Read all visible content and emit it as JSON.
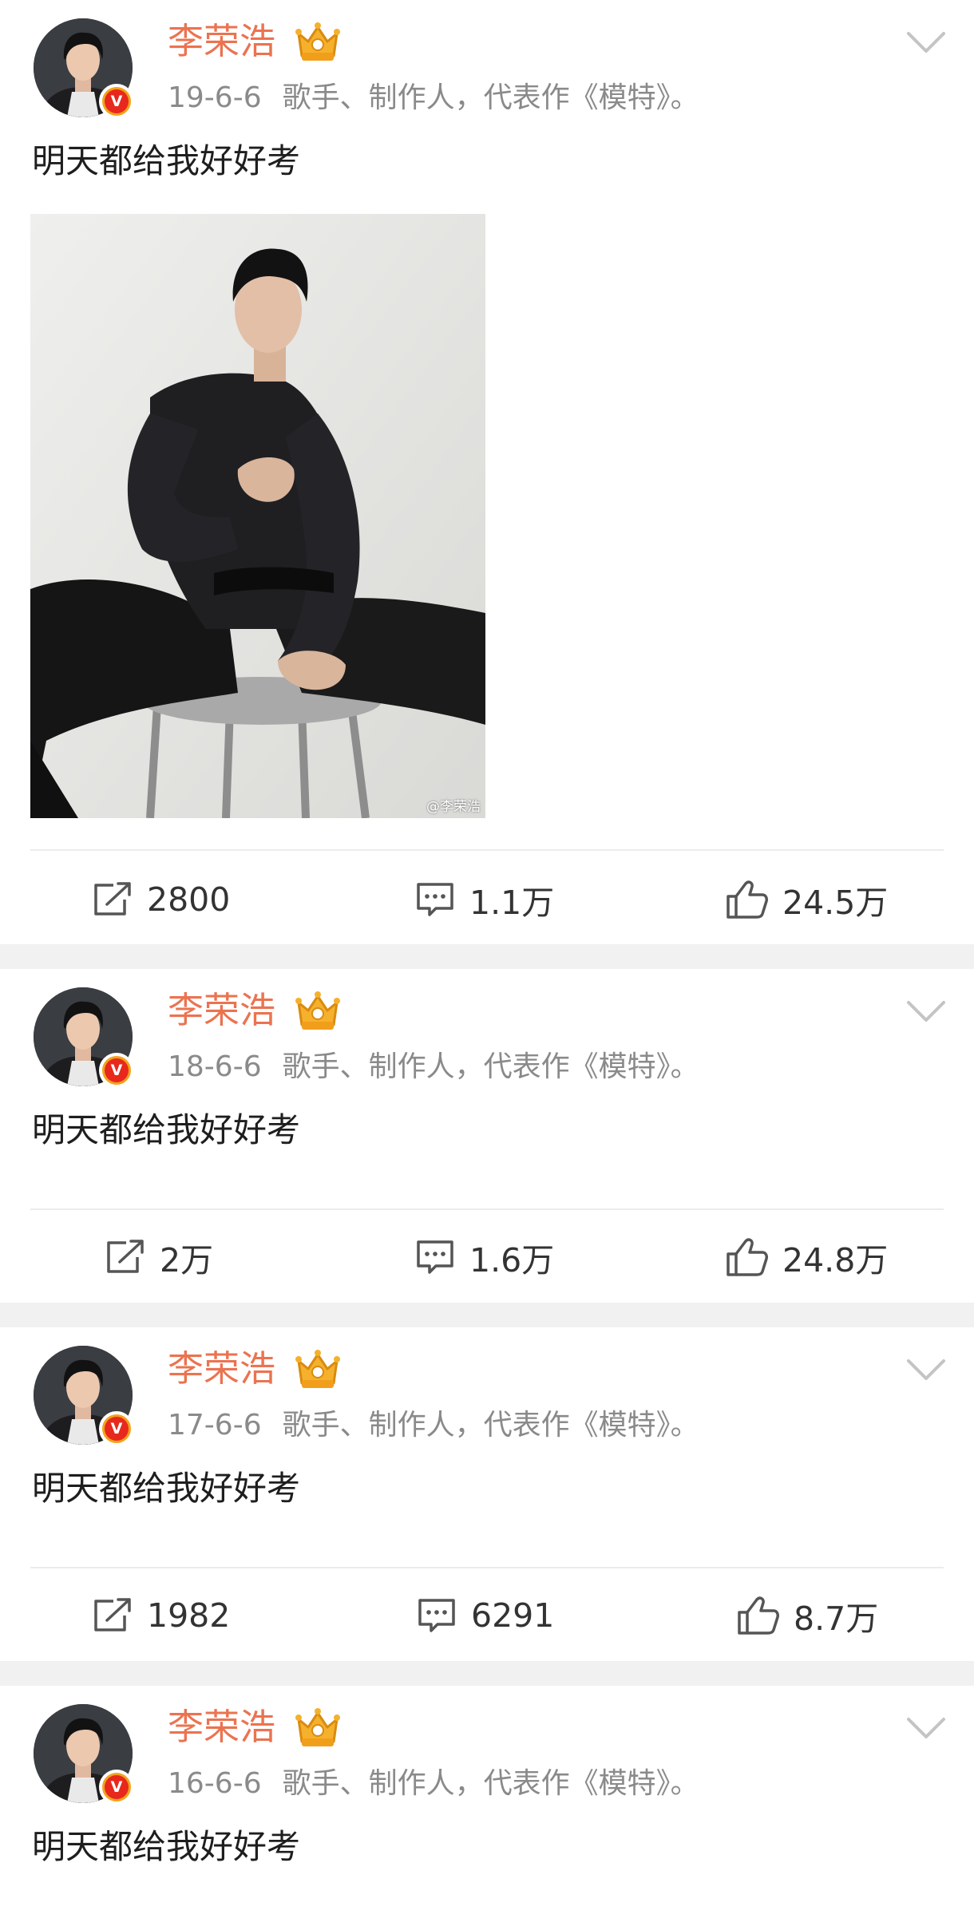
{
  "posts": [
    {
      "username": "李荣浩",
      "date": "19-6-6",
      "bio": "歌手、制作人，代表作《模特》。",
      "text": "明天都给我好好考",
      "has_photo": true,
      "photo_watermark": "@李荣浩",
      "repost_count": "2800",
      "comment_count": "1.1万",
      "like_count": "24.5万"
    },
    {
      "username": "李荣浩",
      "date": "18-6-6",
      "bio": "歌手、制作人，代表作《模特》。",
      "text": "明天都给我好好考",
      "has_photo": false,
      "repost_count": "2万",
      "comment_count": "1.6万",
      "like_count": "24.8万"
    },
    {
      "username": "李荣浩",
      "date": "17-6-6",
      "bio": "歌手、制作人，代表作《模特》。",
      "text": "明天都给我好好考",
      "has_photo": false,
      "repost_count": "1982",
      "comment_count": "6291",
      "like_count": "8.7万"
    },
    {
      "username": "李荣浩",
      "date": "16-6-6",
      "bio": "歌手、制作人，代表作《模特》。",
      "text": "明天都给我好好考",
      "has_photo": false,
      "truncated": true
    }
  ],
  "verified_badge": "V",
  "icons": {
    "repost": "repost-icon",
    "comment": "comment-icon",
    "like": "like-icon",
    "dropdown": "chevron-down-icon",
    "member": "crown-icon"
  },
  "colors": {
    "username": "#eb7350",
    "meta": "#8a8a8a",
    "separator": "#f1f1f1",
    "verified_outer": "#f2a31b",
    "verified_inner": "#e8281c"
  }
}
